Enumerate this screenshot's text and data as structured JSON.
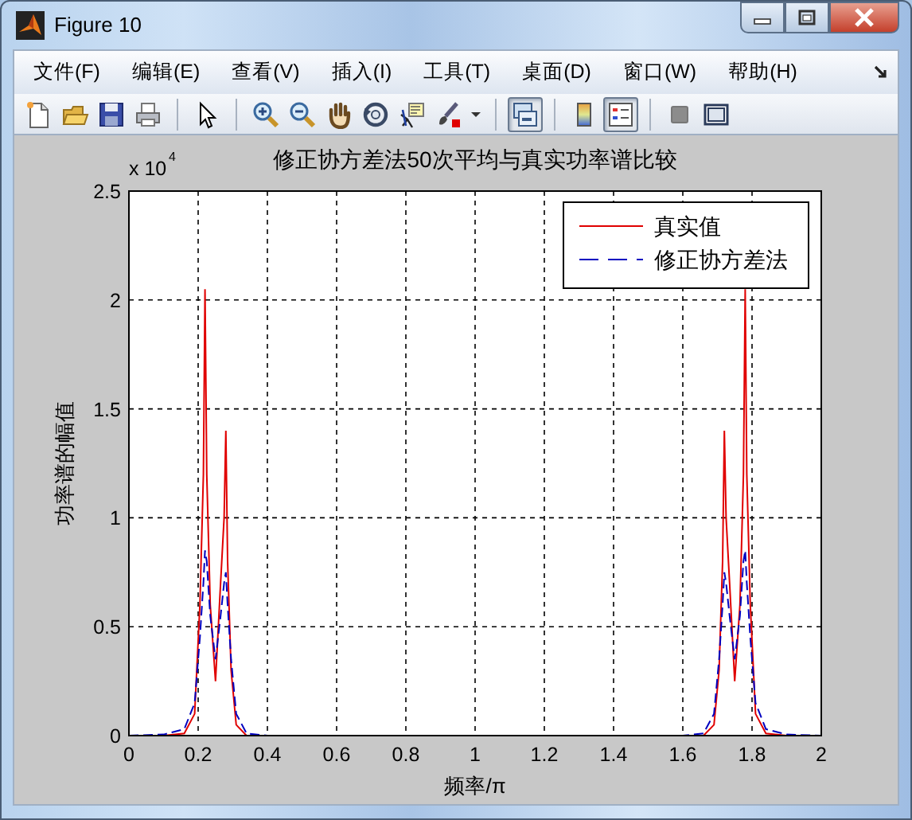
{
  "window": {
    "title": "Figure 10"
  },
  "menu": [
    {
      "label": "文件(F)"
    },
    {
      "label": "编辑(E)"
    },
    {
      "label": "查看(V)"
    },
    {
      "label": "插入(I)"
    },
    {
      "label": "工具(T)"
    },
    {
      "label": "桌面(D)"
    },
    {
      "label": "窗口(W)"
    },
    {
      "label": "帮助(H)"
    }
  ],
  "toolbar": [
    {
      "kind": "new-file",
      "pressed": false
    },
    {
      "kind": "open-folder",
      "pressed": false
    },
    {
      "kind": "save",
      "pressed": false
    },
    {
      "kind": "print",
      "pressed": false
    },
    {
      "kind": "separator"
    },
    {
      "kind": "pointer",
      "pressed": false
    },
    {
      "kind": "separator"
    },
    {
      "kind": "zoom-in",
      "pressed": false
    },
    {
      "kind": "zoom-out",
      "pressed": false
    },
    {
      "kind": "pan",
      "pressed": false
    },
    {
      "kind": "rotate",
      "pressed": false
    },
    {
      "kind": "data-cursor",
      "pressed": false
    },
    {
      "kind": "brush",
      "pressed": false
    },
    {
      "kind": "caret",
      "pressed": false
    },
    {
      "kind": "separator"
    },
    {
      "kind": "link",
      "pressed": true
    },
    {
      "kind": "separator"
    },
    {
      "kind": "colorbar",
      "pressed": false
    },
    {
      "kind": "legend",
      "pressed": true
    },
    {
      "kind": "separator"
    },
    {
      "kind": "hide-tools",
      "pressed": false
    },
    {
      "kind": "show-tools",
      "pressed": false
    }
  ],
  "axes": {
    "multiplier": {
      "base": "x 10",
      "exponent": "4"
    },
    "chart_data": {
      "type": "line",
      "title": "修正协方差法50次平均与真实功率谱比较",
      "xlabel": "频率/π",
      "ylabel": "功率谱的幅值",
      "x": [
        0,
        0.1,
        0.16,
        0.19,
        0.205,
        0.215,
        0.22,
        0.225,
        0.235,
        0.25,
        0.265,
        0.275,
        0.28,
        0.285,
        0.295,
        0.31,
        0.34,
        0.4,
        1.6,
        1.66,
        1.69,
        1.705,
        1.715,
        1.72,
        1.725,
        1.735,
        1.75,
        1.765,
        1.775,
        1.78,
        1.785,
        1.795,
        1.81,
        1.84,
        1.9,
        2
      ],
      "series": [
        {
          "name": "真实值",
          "color": "#e00000",
          "line_style": "solid",
          "values": [
            0,
            0,
            0.01,
            0.1,
            0.6,
            1.2,
            2.05,
            1.2,
            0.6,
            0.25,
            0.7,
            1.0,
            1.4,
            0.8,
            0.3,
            0.05,
            0,
            0,
            0,
            0,
            0.05,
            0.3,
            0.8,
            1.4,
            1.0,
            0.7,
            0.25,
            0.6,
            1.2,
            2.05,
            1.2,
            0.6,
            0.1,
            0.01,
            0,
            0
          ]
        },
        {
          "name": "修正协方差法",
          "color": "#0000c0",
          "line_style": "dashed",
          "values": [
            0,
            0.005,
            0.03,
            0.15,
            0.45,
            0.7,
            0.85,
            0.8,
            0.55,
            0.35,
            0.55,
            0.7,
            0.75,
            0.6,
            0.35,
            0.1,
            0.01,
            0,
            0,
            0.01,
            0.1,
            0.35,
            0.6,
            0.75,
            0.7,
            0.55,
            0.35,
            0.55,
            0.8,
            0.85,
            0.7,
            0.45,
            0.15,
            0.03,
            0.005,
            0
          ]
        }
      ],
      "xlim": [
        0,
        2
      ],
      "ylim": [
        0,
        2.5
      ],
      "xticks": [
        0,
        0.2,
        0.4,
        0.6,
        0.8,
        1,
        1.2,
        1.4,
        1.6,
        1.8,
        2
      ],
      "yticks": [
        0,
        0.5,
        1,
        1.5,
        2,
        2.5
      ],
      "grid": true,
      "legend": true
    }
  }
}
